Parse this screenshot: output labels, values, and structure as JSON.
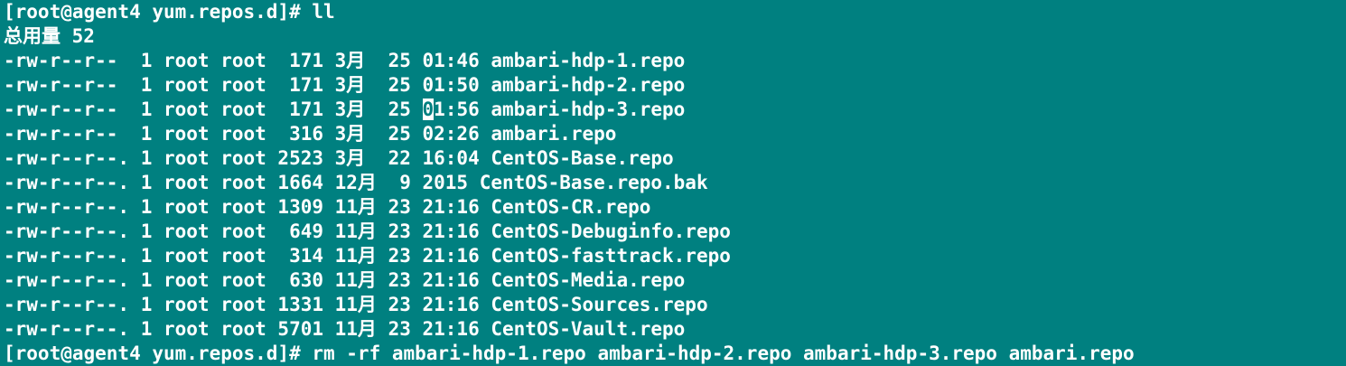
{
  "colors": {
    "background": "#008080",
    "foreground": "#ffffff"
  },
  "prompt1": "[root@agent4 yum.repos.d]# ll",
  "total": "总用量 52",
  "files": [
    "-rw-r--r--  1 root root  171 3月  25 01:46 ambari-hdp-1.repo",
    "-rw-r--r--  1 root root  171 3月  25 01:50 ambari-hdp-2.repo",
    "-rw-r--r--  1 root root  316 3月  25 02:26 ambari.repo",
    "-rw-r--r--. 1 root root 2523 3月  22 16:04 CentOS-Base.repo",
    "-rw-r--r--. 1 root root 1664 12月  9 2015 CentOS-Base.repo.bak",
    "-rw-r--r--. 1 root root 1309 11月 23 21:16 CentOS-CR.repo",
    "-rw-r--r--. 1 root root  649 11月 23 21:16 CentOS-Debuginfo.repo",
    "-rw-r--r--. 1 root root  314 11月 23 21:16 CentOS-fasttrack.repo",
    "-rw-r--r--. 1 root root  630 11月 23 21:16 CentOS-Media.repo",
    "-rw-r--r--. 1 root root 1331 11月 23 21:16 CentOS-Sources.repo",
    "-rw-r--r--. 1 root root 5701 11月 23 21:16 CentOS-Vault.repo"
  ],
  "cursor_line": {
    "before": "-rw-r--r--  1 root root  171 3月  25 ",
    "cursor_char": "0",
    "after": "1:56 ambari-hdp-3.repo"
  },
  "prompt2": "[root@agent4 yum.repos.d]# rm -rf ambari-hdp-1.repo ambari-hdp-2.repo ambari-hdp-3.repo ambari.repo"
}
